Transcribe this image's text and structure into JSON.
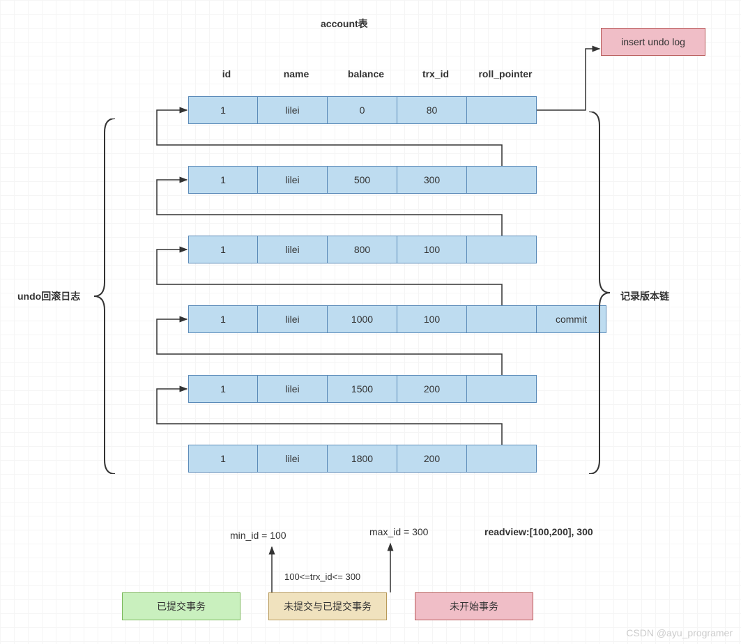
{
  "title": "account表",
  "headers": [
    "id",
    "name",
    "balance",
    "trx_id",
    "roll_pointer"
  ],
  "rows": [
    {
      "id": "1",
      "name": "lilei",
      "balance": "0",
      "trx_id": "80"
    },
    {
      "id": "1",
      "name": "lilei",
      "balance": "500",
      "trx_id": "300"
    },
    {
      "id": "1",
      "name": "lilei",
      "balance": "800",
      "trx_id": "100"
    },
    {
      "id": "1",
      "name": "lilei",
      "balance": "1000",
      "trx_id": "100",
      "extra": "commit"
    },
    {
      "id": "1",
      "name": "lilei",
      "balance": "1500",
      "trx_id": "200"
    },
    {
      "id": "1",
      "name": "lilei",
      "balance": "1800",
      "trx_id": "200"
    }
  ],
  "left_bracket_label": "undo回滚日志",
  "right_bracket_label": "记录版本链",
  "insert_undo_label": "insert undo log",
  "bottom": {
    "min_label": "min_id = 100",
    "max_label": "max_id = 300",
    "range_label": "100<=trx_id<= 300",
    "readview": "readview:[100,200], 300",
    "legends": {
      "committed": "已提交事务",
      "mixed": "未提交与已提交事务",
      "notstarted": "未开始事务"
    }
  },
  "watermark": "CSDN @ayu_programer",
  "chart_data": {
    "type": "table",
    "title": "account表 — MVCC undo log version chain",
    "columns": [
      "id",
      "name",
      "balance",
      "trx_id",
      "roll_pointer"
    ],
    "rows": [
      [
        1,
        "lilei",
        0,
        80,
        "→ insert undo log"
      ],
      [
        1,
        "lilei",
        500,
        300,
        "→ prev"
      ],
      [
        1,
        "lilei",
        800,
        100,
        "→ prev"
      ],
      [
        1,
        "lilei",
        1000,
        100,
        "→ prev (commit)"
      ],
      [
        1,
        "lilei",
        1500,
        200,
        "→ prev"
      ],
      [
        1,
        "lilei",
        1800,
        200,
        "→ prev"
      ]
    ],
    "annotations": {
      "undo_log": "undo回滚日志 (rows 2‑6)",
      "version_chain": "记录版本链 (rows 1‑6)",
      "readview": "readview:[100,200], 300",
      "min_id": 100,
      "max_id": 300,
      "range": "100<=trx_id<=300",
      "legend": [
        "已提交事务",
        "未提交与已提交事务",
        "未开始事务"
      ]
    }
  }
}
